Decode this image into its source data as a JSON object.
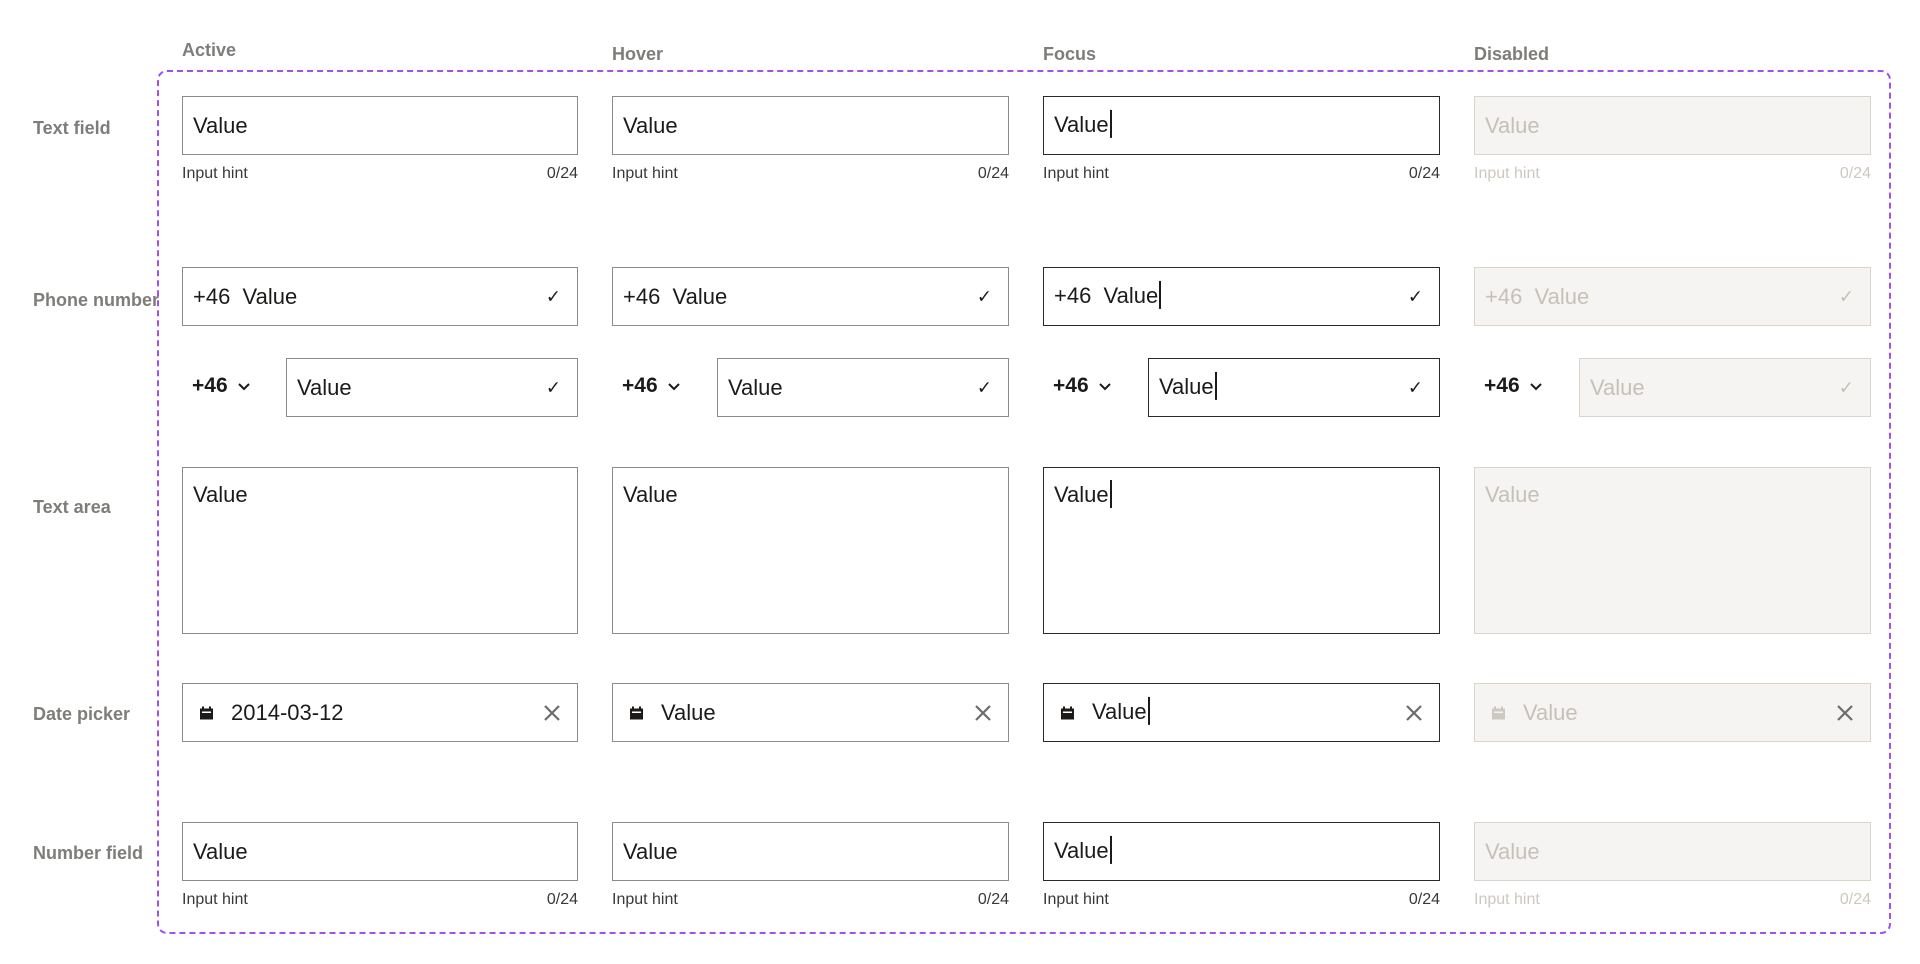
{
  "columns": [
    "Active",
    "Hover",
    "Focus",
    "Disabled"
  ],
  "rows": {
    "text_field": "Text field",
    "phone_number": "Phone number",
    "text_area": "Text area",
    "date_picker": "Date picker",
    "number_field": "Number field"
  },
  "states": [
    {
      "text_value": "Value",
      "hint": "Input hint",
      "count": "0/24",
      "phone_prefix_value": "+46  Value",
      "country_code": "+46",
      "phone_value": "Value",
      "area_value": "Value",
      "date_value": "2014-03-12",
      "number_value": "Value"
    },
    {
      "text_value": "Value",
      "hint": "Input hint",
      "count": "0/24",
      "phone_prefix_value": "+46  Value",
      "country_code": "+46",
      "phone_value": "Value",
      "area_value": "Value",
      "date_value": "Value",
      "number_value": "Value"
    },
    {
      "text_value": "Value",
      "hint": "Input hint",
      "count": "0/24",
      "phone_prefix_value": "+46  Value",
      "country_code": "+46",
      "phone_value": "Value",
      "area_value": "Value",
      "date_value": "Value",
      "number_value": "Value"
    },
    {
      "text_value": "Value",
      "hint": "Input hint",
      "count": "0/24",
      "phone_prefix_value": "+46  Value",
      "country_code": "+46",
      "phone_value": "Value",
      "area_value": "Value",
      "date_value": "Value",
      "number_value": "Value"
    }
  ],
  "icons": {
    "check": "check-icon",
    "chevron": "chevron-down-icon",
    "calendar": "calendar-icon",
    "clear": "close-icon"
  },
  "colors": {
    "frame": "#a050f0",
    "border": "#8d8b89",
    "focus_border": "#2b2a29",
    "disabled_bg": "#f5f4f2",
    "disabled_text": "#c6c1b8"
  }
}
